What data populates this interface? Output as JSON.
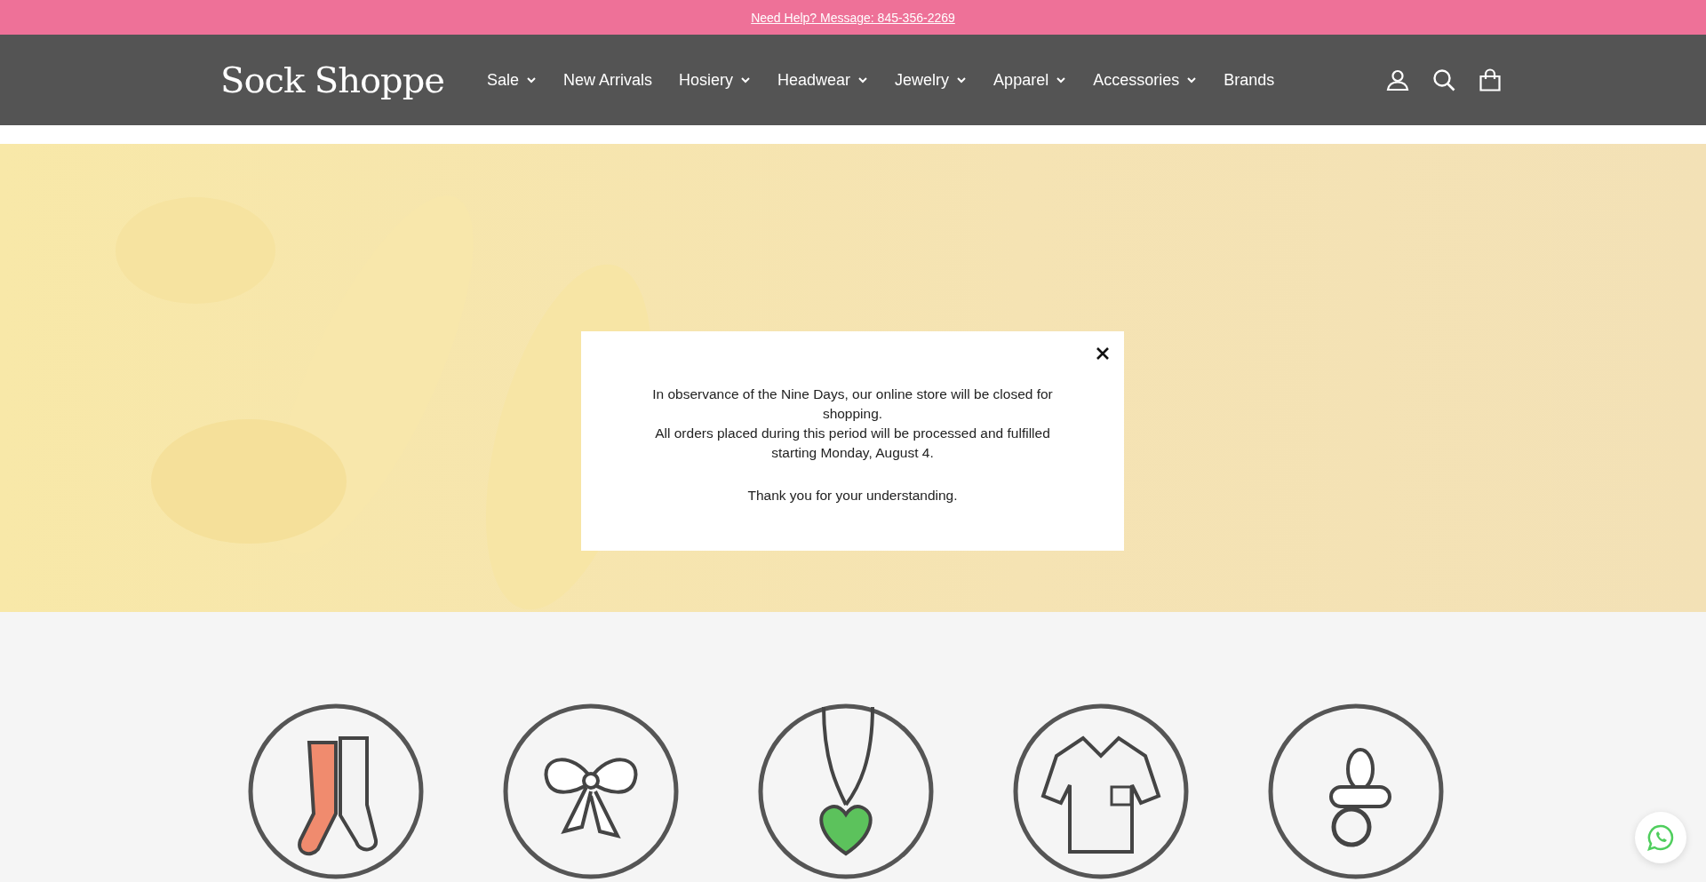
{
  "announcement": {
    "link": "Need Help? Message: 845-356-2269"
  },
  "header": {
    "logo": "Sock Shoppe",
    "nav": [
      {
        "label": "Sale",
        "has_dropdown": true
      },
      {
        "label": "New Arrivals",
        "has_dropdown": false
      },
      {
        "label": "Hosiery",
        "has_dropdown": true
      },
      {
        "label": "Headwear",
        "has_dropdown": true
      },
      {
        "label": "Jewelry",
        "has_dropdown": true
      },
      {
        "label": "Apparel",
        "has_dropdown": true
      },
      {
        "label": "Accessories",
        "has_dropdown": true
      },
      {
        "label": "Brands",
        "has_dropdown": false
      }
    ]
  },
  "modal": {
    "sections": [
      {
        "paragraphs": [
          "In observance of the Nine Days, our online store will be closed for shopping.",
          "All orders placed during this period will be processed and fulfilled starting Monday, August 4."
        ]
      },
      {
        "paragraphs": [
          "Thank you for your understanding."
        ]
      }
    ]
  }
}
